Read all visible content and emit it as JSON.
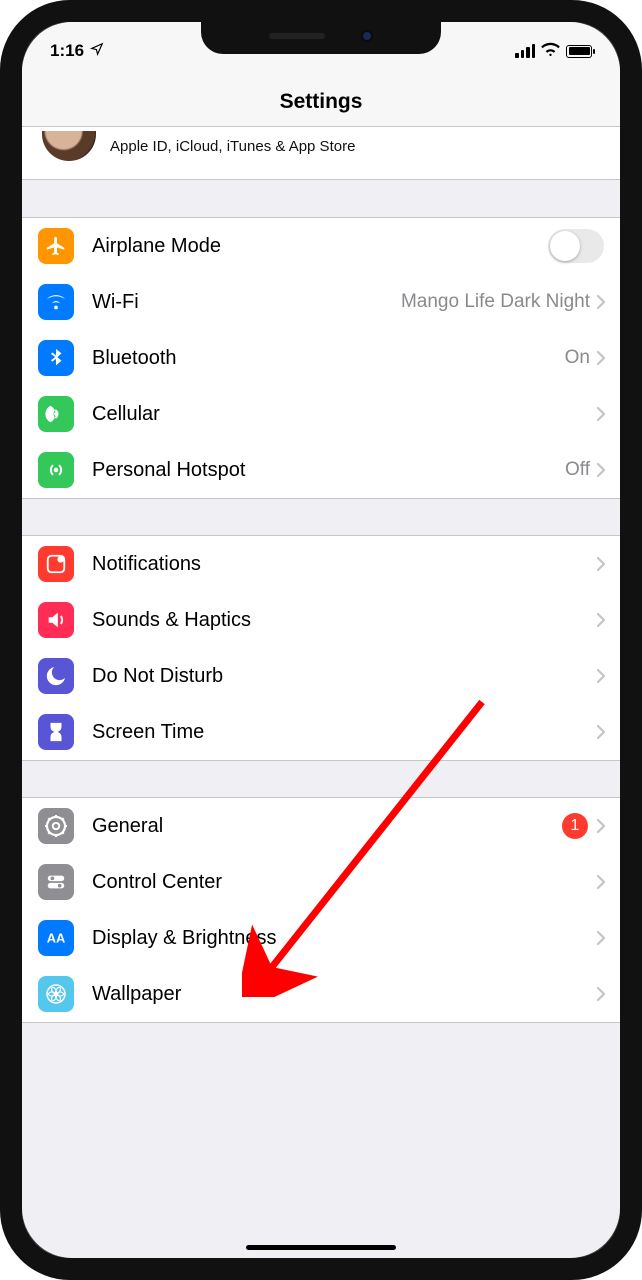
{
  "status": {
    "time": "1:16"
  },
  "header": {
    "title": "Settings"
  },
  "account": {
    "subtitle": "Apple ID, iCloud, iTunes & App Store"
  },
  "groups": [
    {
      "rows": [
        {
          "icon": "airplane",
          "iconColor": "#ff9500",
          "label": "Airplane Mode",
          "toggle": false
        },
        {
          "icon": "wifi",
          "iconColor": "#007aff",
          "label": "Wi-Fi",
          "value": "Mango Life Dark Night",
          "chevron": true
        },
        {
          "icon": "bluetooth",
          "iconColor": "#007aff",
          "label": "Bluetooth",
          "value": "On",
          "chevron": true
        },
        {
          "icon": "cellular",
          "iconColor": "#34c759",
          "label": "Cellular",
          "chevron": true
        },
        {
          "icon": "hotspot",
          "iconColor": "#34c759",
          "label": "Personal Hotspot",
          "value": "Off",
          "chevron": true
        }
      ]
    },
    {
      "rows": [
        {
          "icon": "notifications",
          "iconColor": "#ff3b30",
          "label": "Notifications",
          "chevron": true
        },
        {
          "icon": "sounds",
          "iconColor": "#ff2d55",
          "label": "Sounds & Haptics",
          "chevron": true
        },
        {
          "icon": "dnd",
          "iconColor": "#5856d6",
          "label": "Do Not Disturb",
          "chevron": true
        },
        {
          "icon": "screentime",
          "iconColor": "#5856d6",
          "label": "Screen Time",
          "chevron": true
        }
      ]
    },
    {
      "rows": [
        {
          "icon": "general",
          "iconColor": "#8e8e93",
          "label": "General",
          "badge": "1",
          "chevron": true
        },
        {
          "icon": "controlcenter",
          "iconColor": "#8e8e93",
          "label": "Control Center",
          "chevron": true
        },
        {
          "icon": "display",
          "iconColor": "#007aff",
          "label": "Display & Brightness",
          "chevron": true
        },
        {
          "icon": "wallpaper",
          "iconColor": "#54c7ec",
          "label": "Wallpaper",
          "chevron": true
        }
      ]
    }
  ],
  "annotation": {
    "arrowColor": "#ff0000"
  }
}
